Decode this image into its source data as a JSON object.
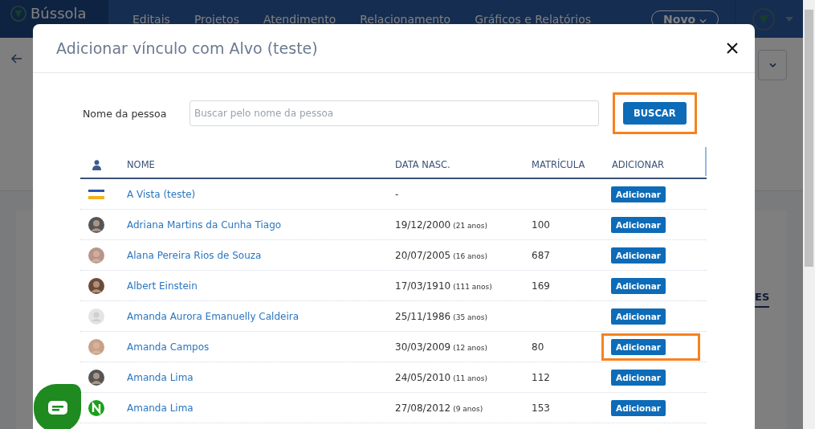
{
  "navbar": {
    "logo": "Bússola",
    "items": [
      "Editais",
      "Projetos",
      "Atendimento",
      "Relacionamento",
      "Gráficos e Relatórios"
    ],
    "new_button": "Novo"
  },
  "background": {
    "tab_fragment": "ES"
  },
  "modal": {
    "title": "Adicionar vínculo com Alvo (teste)",
    "search": {
      "label": "Nome da pessoa",
      "placeholder": "Buscar pelo nome da pessoa",
      "button": "BUSCAR",
      "highlighted": true
    },
    "table": {
      "columns": [
        "NOME",
        "DATA NASC.",
        "MATRÍCULA",
        "ADICIONAR"
      ],
      "rows": [
        {
          "kind": "card",
          "name": "A Vista (teste)",
          "birth": "-",
          "matricula": "",
          "button": "Adicionar",
          "highlighted": false
        },
        {
          "kind": "photo",
          "name": "Adriana Martins da Cunha Tiago",
          "birth": "19/12/2000",
          "age": "(21 anos)",
          "matricula": "100",
          "button": "Adicionar",
          "highlighted": false
        },
        {
          "kind": "photo",
          "name": "Alana Pereira Rios de Souza",
          "birth": "20/07/2005",
          "age": "(16 anos)",
          "matricula": "687",
          "button": "Adicionar",
          "highlighted": false
        },
        {
          "kind": "photo",
          "name": "Albert Einstein",
          "birth": "17/03/1910",
          "age": "(111 anos)",
          "matricula": "169",
          "button": "Adicionar",
          "highlighted": false
        },
        {
          "kind": "placeholder",
          "name": "Amanda Aurora Emanuelly Caldeira",
          "birth": "25/11/1986",
          "age": "(35 anos)",
          "matricula": "",
          "button": "Adicionar",
          "highlighted": false
        },
        {
          "kind": "photo",
          "name": "Amanda Campos",
          "birth": "30/03/2009",
          "age": "(12 anos)",
          "matricula": "80",
          "button": "Adicionar",
          "highlighted": true
        },
        {
          "kind": "photo",
          "name": "Amanda Lima",
          "birth": "24/05/2010",
          "age": "(11 anos)",
          "matricula": "112",
          "button": "Adicionar",
          "highlighted": false
        },
        {
          "kind": "logo",
          "name": "Amanda Lima",
          "birth": "27/08/2012",
          "age": "(9 anos)",
          "matricula": "153",
          "button": "Adicionar",
          "highlighted": false
        }
      ]
    }
  }
}
